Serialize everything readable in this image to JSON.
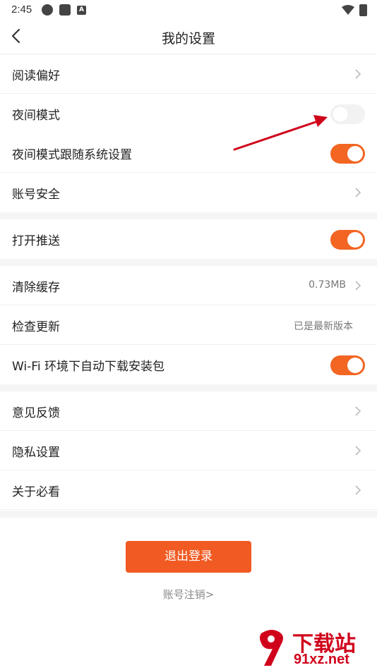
{
  "status_bar": {
    "time": "2:45",
    "notif_icon_a": "A"
  },
  "header": {
    "title": "我的设置",
    "back_icon": "chevron-left-icon"
  },
  "groups": {
    "reading": {
      "label": "阅读偏好"
    },
    "night_mode": {
      "label": "夜间模式",
      "on": false
    },
    "night_follow": {
      "label": "夜间模式跟随系统设置",
      "on": true
    },
    "account_security": {
      "label": "账号安全"
    },
    "push": {
      "label": "打开推送",
      "on": true
    },
    "clear_cache": {
      "label": "清除缓存",
      "value": "0.73MB"
    },
    "check_update": {
      "label": "检查更新",
      "value": "已是最新版本"
    },
    "wifi_download": {
      "label": "Wi-Fi 环境下自动下载安装包",
      "on": true
    },
    "feedback": {
      "label": "意见反馈"
    },
    "privacy": {
      "label": "隐私设置"
    },
    "about": {
      "label": "关于必看"
    }
  },
  "actions": {
    "logout": "退出登录",
    "cancel_account": "账号注销>"
  },
  "watermark": {
    "title": "下载站",
    "sub": "91xz.net"
  },
  "colors": {
    "accent": "#f26522",
    "logout": "#f15a22",
    "annotation_arrow": "#d0021b"
  }
}
